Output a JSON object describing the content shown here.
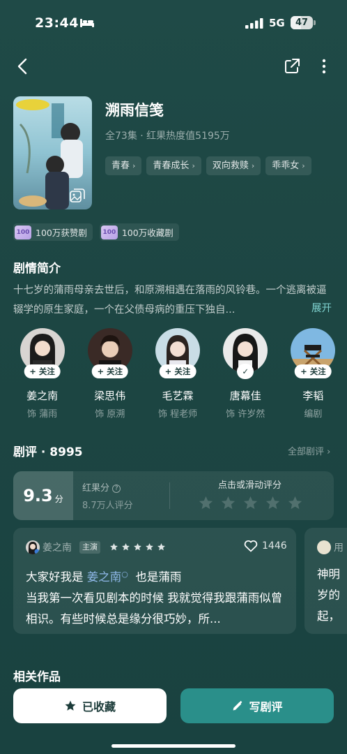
{
  "status_bar": {
    "time": "23:44",
    "network": "5G",
    "battery": "47",
    "battery_level": 0.47
  },
  "drama": {
    "title": "溯雨信笺",
    "meta": "全73集 · 红果热度值5195万",
    "tags": [
      "青春",
      "青春成长",
      "双向救赎",
      "乖乖女"
    ],
    "badges": [
      {
        "icon_text": "100",
        "label": "100万获赞剧"
      },
      {
        "icon_text": "100",
        "label": "100万收藏剧"
      }
    ]
  },
  "synopsis": {
    "title": "剧情简介",
    "text": "十七岁的蒲雨母亲去世后，和原溯相遇在落雨的风铃巷。一个逃离被逼辍学的原生家庭，一个在父债母病的重压下独自...",
    "expand": "展开"
  },
  "cast": [
    {
      "name": "姜之南",
      "role": "饰 蒲雨",
      "follow": "+ 关注",
      "followed": false
    },
    {
      "name": "梁思伟",
      "role": "饰 原溯",
      "follow": "+ 关注",
      "followed": false
    },
    {
      "name": "毛艺霖",
      "role": "饰 程老师",
      "follow": "+ 关注",
      "followed": false
    },
    {
      "name": "唐幕佳",
      "role": "饰 许岁然",
      "follow": "✓",
      "followed": true
    },
    {
      "name": "李韬",
      "role": "编剧",
      "follow": "+ 关注",
      "followed": false
    }
  ],
  "reviews": {
    "title": "剧评 · 8995",
    "all": "全部剧评",
    "score": "9.3",
    "score_unit": "分",
    "score_label": "红果分",
    "score_count": "8.7万人评分",
    "rate_hint": "点击或滑动评分",
    "items": [
      {
        "author": "姜之南",
        "badge": "主演",
        "stars": 5,
        "likes": "1446",
        "line1_prefix": "大家好我是 ",
        "mention": "姜之南",
        "line1_suffix": "  也是蒲雨",
        "rest": "当我第一次看见剧本的时候 我就觉得我跟蒲雨似曾相识。有些时候总是缘分很巧妙，所..."
      },
      {
        "author": "用",
        "lines": [
          "神明",
          "岁的",
          "起，"
        ]
      }
    ]
  },
  "related": {
    "title": "相关作品"
  },
  "actions": {
    "collected": "已收藏",
    "write_review": "写剧评"
  },
  "colors": {
    "accent": "#2a8f8a",
    "background": "#1f4a47",
    "link": "#7fd3d0"
  },
  "icons": [
    "back-icon",
    "share-icon",
    "more-icon",
    "bed-icon",
    "signal-icon",
    "star-icon",
    "heart-icon",
    "pencil-icon",
    "gallery-icon"
  ]
}
